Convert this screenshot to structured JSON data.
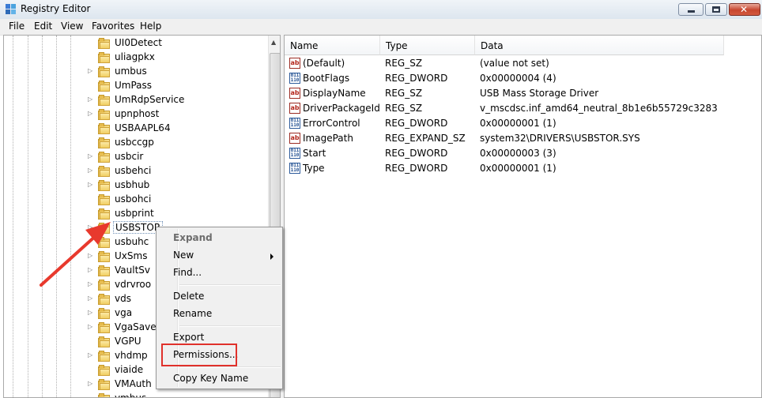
{
  "window": {
    "title": "Registry Editor",
    "close_glyph": "✕"
  },
  "menu": [
    "File",
    "Edit",
    "View",
    "Favorites",
    "Help"
  ],
  "tree": {
    "items": [
      {
        "label": "UI0Detect",
        "expandable": false
      },
      {
        "label": "uliagpkx",
        "expandable": false
      },
      {
        "label": "umbus",
        "expandable": true
      },
      {
        "label": "UmPass",
        "expandable": false
      },
      {
        "label": "UmRdpService",
        "expandable": true
      },
      {
        "label": "upnphost",
        "expandable": true
      },
      {
        "label": "USBAAPL64",
        "expandable": false
      },
      {
        "label": "usbccgp",
        "expandable": false
      },
      {
        "label": "usbcir",
        "expandable": true
      },
      {
        "label": "usbehci",
        "expandable": true
      },
      {
        "label": "usbhub",
        "expandable": true
      },
      {
        "label": "usbohci",
        "expandable": false
      },
      {
        "label": "usbprint",
        "expandable": false
      },
      {
        "label": "USBSTOR",
        "expandable": true,
        "selected": true
      },
      {
        "label": "usbuhc",
        "expandable": false
      },
      {
        "label": "UxSms",
        "expandable": true
      },
      {
        "label": "VaultSv",
        "expandable": true
      },
      {
        "label": "vdrvroo",
        "expandable": true
      },
      {
        "label": "vds",
        "expandable": true
      },
      {
        "label": "vga",
        "expandable": true
      },
      {
        "label": "VgaSave",
        "expandable": true
      },
      {
        "label": "VGPU",
        "expandable": false
      },
      {
        "label": "vhdmp",
        "expandable": true
      },
      {
        "label": "viaide",
        "expandable": false
      },
      {
        "label": "VMAuth",
        "expandable": true
      },
      {
        "label": "vmbus",
        "expandable": false
      }
    ]
  },
  "values": {
    "columns": [
      "Name",
      "Type",
      "Data"
    ],
    "rows": [
      {
        "icon": "string-value-icon",
        "name": "(Default)",
        "type": "REG_SZ",
        "data": "(value not set)"
      },
      {
        "icon": "binary-value-icon",
        "name": "BootFlags",
        "type": "REG_DWORD",
        "data": "0x00000004 (4)"
      },
      {
        "icon": "string-value-icon",
        "name": "DisplayName",
        "type": "REG_SZ",
        "data": "USB Mass Storage Driver"
      },
      {
        "icon": "string-value-icon",
        "name": "DriverPackageId",
        "type": "REG_SZ",
        "data": "v_mscdsc.inf_amd64_neutral_8b1e6b55729c3283"
      },
      {
        "icon": "binary-value-icon",
        "name": "ErrorControl",
        "type": "REG_DWORD",
        "data": "0x00000001 (1)"
      },
      {
        "icon": "string-value-icon",
        "name": "ImagePath",
        "type": "REG_EXPAND_SZ",
        "data": "system32\\DRIVERS\\USBSTOR.SYS"
      },
      {
        "icon": "binary-value-icon",
        "name": "Start",
        "type": "REG_DWORD",
        "data": "0x00000003 (3)"
      },
      {
        "icon": "binary-value-icon",
        "name": "Type",
        "type": "REG_DWORD",
        "data": "0x00000001 (1)"
      }
    ]
  },
  "context_menu": {
    "expand": "Expand",
    "new": "New",
    "find": "Find...",
    "delete": "Delete",
    "rename": "Rename",
    "export": "Export",
    "permissions": "Permissions...",
    "copy_key_name": "Copy Key Name"
  },
  "icons": {
    "string_value": "ab",
    "binary_value": "011\n110"
  },
  "colors": {
    "annotation_red": "#e0312b",
    "arrow_red": "#e8392d"
  }
}
